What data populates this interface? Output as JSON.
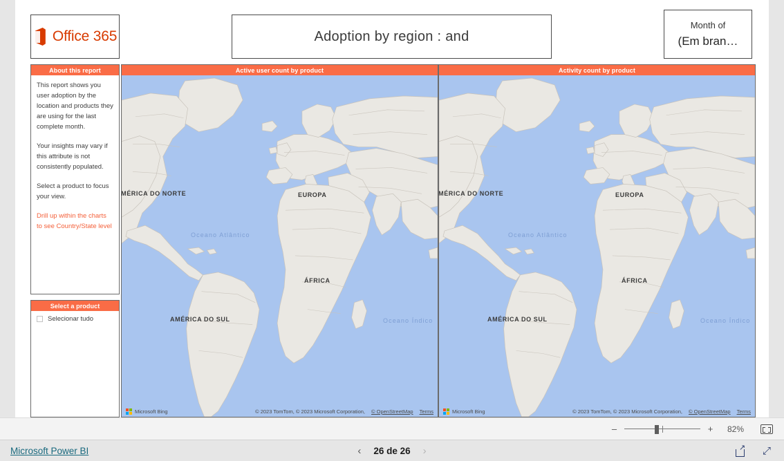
{
  "header": {
    "logo_text": "Office 365",
    "logo_color": "#d83b01",
    "report_title": "Adoption by region :  and",
    "month_slicer_label": "Month of",
    "month_slicer_value": "(Em bran…"
  },
  "about_panel": {
    "title": "About this report",
    "paragraphs": [
      "This report shows you user adoption by the location and products they are using for the last complete month.",
      "Your insights may vary if this attribute is not consistently populated.",
      "Select a product to focus your view."
    ],
    "accent_note": "Drill up within the charts to see Country/State level",
    "accent_color": "#f4603a"
  },
  "product_panel": {
    "title": "Select a product",
    "items": [
      {
        "label": "Selecionar tudo",
        "checked": false
      }
    ]
  },
  "maps": [
    {
      "title": "Active user count by product",
      "labels": [
        "AMÉRICA DO NORTE",
        "EUROPA",
        "ÁFRICA",
        "AMÉRICA DO SUL"
      ],
      "ocean_labels": [
        "Oceano Atlântico",
        "Oceano Índico"
      ],
      "brand": "Microsoft Bing",
      "attribution": "© 2023 TomTom, © 2023 Microsoft Corporation,",
      "attribution_link": "© OpenStreetMap",
      "terms_link": "Terms"
    },
    {
      "title": "Activity count by product",
      "labels": [
        "AMÉRICA DO NORTE",
        "EUROPA",
        "ÁFRICA",
        "AMÉRICA DO SUL"
      ],
      "ocean_labels": [
        "Oceano Atlântico",
        "Oceano Índico"
      ],
      "brand": "Microsoft Bing",
      "attribution": "© 2023 TomTom, © 2023 Microsoft Corporation,",
      "attribution_link": "© OpenStreetMap",
      "terms_link": "Terms"
    }
  ],
  "map_style": {
    "water_color": "#a9c5ef",
    "land_color": "#eae8e3",
    "border_color": "#c8c3bb",
    "header_color": "#fa6c46"
  },
  "zoom_bar": {
    "minus": "–",
    "plus": "+",
    "percent": "82%"
  },
  "status_bar": {
    "brand_link": "Microsoft Power BI",
    "prev_arrow": "‹",
    "next_arrow": "›",
    "page_text": "26 de 26",
    "share_icon": "share-icon",
    "fullscreen_icon": "fullscreen-icon"
  }
}
